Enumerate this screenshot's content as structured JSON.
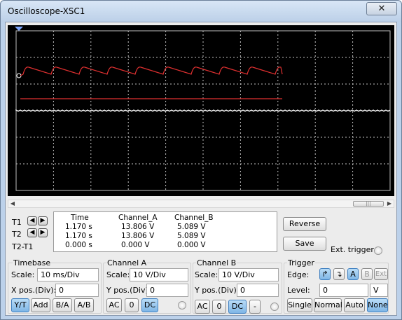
{
  "window": {
    "title": "Oscilloscope-XSC1",
    "close_glyph": "✕"
  },
  "colors": {
    "screen_bg": "#000000",
    "grid": "#bfbfbf",
    "channel_a": "#e03030",
    "channel_b": "#ffffff",
    "button_active": "#7fb6e6"
  },
  "cursors": {
    "t1_label": "T1",
    "t2_label": "T2",
    "diff_label": "T2-T1",
    "left_arrow": "◀",
    "right_arrow": "▶"
  },
  "readout": {
    "headers": [
      "Time",
      "Channel_A",
      "Channel_B"
    ],
    "rows": [
      [
        "1.170 s",
        "13.806 V",
        "5.089 V"
      ],
      [
        "1.170 s",
        "13.806 V",
        "5.089 V"
      ],
      [
        "0.000 s",
        "0.000 V",
        "0.000 V"
      ]
    ]
  },
  "actions": {
    "reverse": "Reverse",
    "save": "Save",
    "ext_trigger": "Ext. trigger"
  },
  "timebase": {
    "title": "Timebase",
    "scale_label": "Scale:",
    "scale_value": "10 ms/Div",
    "xpos_label": "X pos.(Div):",
    "xpos_value": "0",
    "modes": [
      "Y/T",
      "Add",
      "B/A",
      "A/B"
    ]
  },
  "channel_a": {
    "title": "Channel A",
    "scale_label": "Scale:",
    "scale_value": "10  V/Div",
    "ypos_label": "Y pos.(Div):",
    "ypos_value": "0",
    "coupling": [
      "AC",
      "0",
      "DC"
    ]
  },
  "channel_b": {
    "title": "Channel B",
    "scale_label": "Scale:",
    "scale_value": "10  V/Div",
    "ypos_label": "Y pos.(Div):",
    "ypos_value": "0",
    "coupling": [
      "AC",
      "0",
      "DC",
      "-"
    ]
  },
  "trigger": {
    "title": "Trigger",
    "edge_label": "Edge:",
    "edge_rise": "↱",
    "edge_fall": "↴",
    "sources": [
      "A",
      "B",
      "Ext"
    ],
    "level_label": "Level:",
    "level_value": "0",
    "level_unit": "V",
    "modes": [
      "Single",
      "Normal",
      "Auto",
      "None"
    ]
  },
  "scrollbar": {
    "left": "◀",
    "right": "▶",
    "thumb": "|||"
  }
}
